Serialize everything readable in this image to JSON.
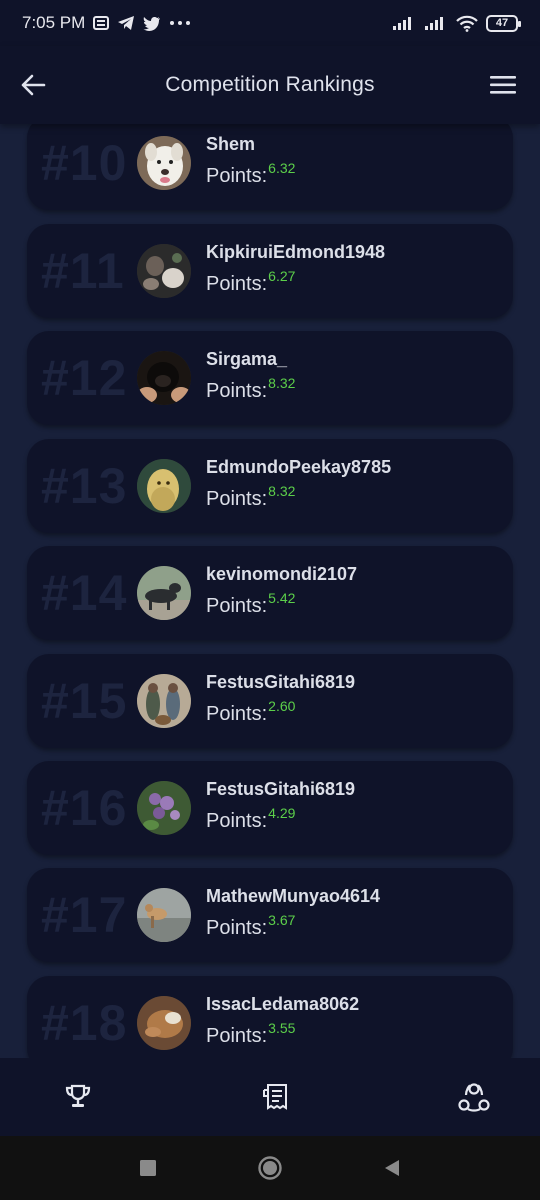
{
  "status_bar": {
    "time": "7:05 PM",
    "notification_icons": [
      "news-icon",
      "telegram-icon",
      "twitter-icon",
      "more-dots-icon"
    ],
    "battery": "47"
  },
  "app_bar": {
    "title": "Competition Rankings"
  },
  "points_label": "Points:",
  "colors": {
    "background": "#18203a",
    "card": "#0f1329",
    "points_value": "#5ccf4a",
    "rank_text": "#1d243f"
  },
  "rankings": [
    {
      "rank": "#10",
      "username": "Shem",
      "points": "6.32"
    },
    {
      "rank": "#11",
      "username": "KipkiruiEdmond1948",
      "points": "6.27"
    },
    {
      "rank": "#12",
      "username": "Sirgama_",
      "points": "8.32"
    },
    {
      "rank": "#13",
      "username": "EdmundoPeekay8785",
      "points": "8.32"
    },
    {
      "rank": "#14",
      "username": "kevinomondi2107",
      "points": "5.42"
    },
    {
      "rank": "#15",
      "username": "FestusGitahi6819",
      "points": "2.60"
    },
    {
      "rank": "#16",
      "username": "FestusGitahi6819",
      "points": "4.29"
    },
    {
      "rank": "#17",
      "username": "MathewMunyao4614",
      "points": "3.67"
    },
    {
      "rank": "#18",
      "username": "IssacLedama8062",
      "points": "3.55"
    }
  ],
  "bottom_nav": [
    "trophy-icon",
    "receipt-icon",
    "community-icon"
  ],
  "system_nav": [
    "recents-icon",
    "home-icon",
    "back-triangle-icon"
  ]
}
